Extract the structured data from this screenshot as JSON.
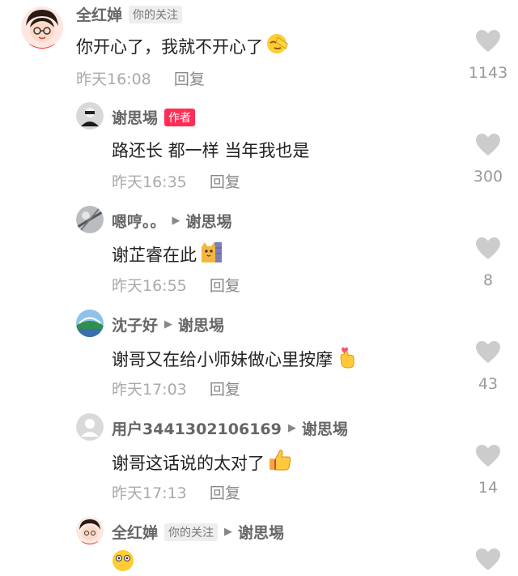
{
  "comments": [
    {
      "username": "全红婵",
      "tag": "你的关注",
      "text": "你开心了，我就不开心了",
      "emoji": "face-palm-emoji",
      "time": "昨天16:08",
      "reply_label": "回复",
      "likes": "1143"
    },
    {
      "username": "谢思埸",
      "tag": "作者",
      "text": "路还长 都一样 当年我也是",
      "time": "昨天16:35",
      "reply_label": "回复",
      "likes": "300"
    },
    {
      "username": "嗯哼。。",
      "reply_to": "谢思埸",
      "text": "谢芷睿在此",
      "emoji": "cat-peek-emoji",
      "time": "昨天16:55",
      "reply_label": "回复",
      "likes": "8"
    },
    {
      "username": "沈子好",
      "reply_to": "谢思埸",
      "text": "谢哥又在给小师妹做心里按摩",
      "emoji": "finger-heart-emoji",
      "time": "昨天17:03",
      "reply_label": "回复",
      "likes": "43"
    },
    {
      "username": "用户3441302106169",
      "reply_to": "谢思埸",
      "text": "谢哥这话说的太对了",
      "emoji": "thumbs-up-emoji",
      "time": "昨天17:13",
      "reply_label": "回复",
      "likes": "14"
    },
    {
      "username": "全红婵",
      "tag": "你的关注",
      "reply_to": "谢思埸",
      "emoji": "shocked-face-emoji"
    }
  ],
  "colors": {
    "author_tag": "#ff2d55",
    "heart": "#cccccc",
    "meta": "#aaaaaa"
  }
}
